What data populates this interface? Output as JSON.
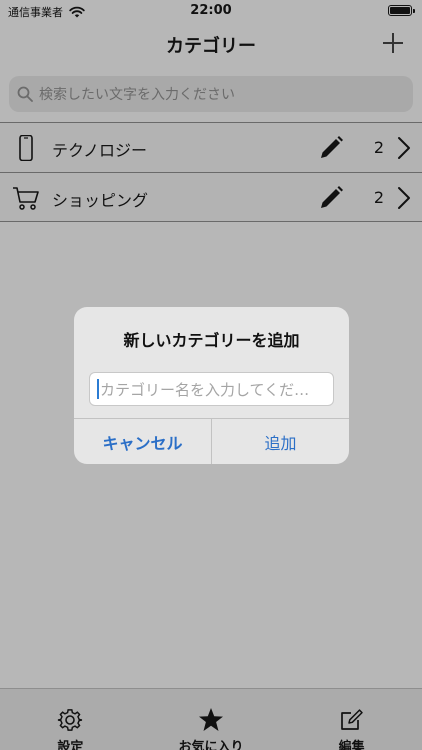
{
  "status_bar": {
    "carrier": "通信事業者",
    "time": "22:00"
  },
  "nav": {
    "title": "カテゴリー",
    "add_icon": "plus-icon"
  },
  "search": {
    "placeholder": "検索したい文字を入力ください",
    "icon": "search-icon"
  },
  "categories": [
    {
      "icon": "phone-icon",
      "label": "テクノロジー",
      "count": "2"
    },
    {
      "icon": "cart-icon",
      "label": "ショッピング",
      "count": "2"
    }
  ],
  "alert": {
    "title": "新しいカテゴリーを追加",
    "placeholder": "カテゴリー名を入力してくだ…",
    "cancel": "キャンセル",
    "add": "追加"
  },
  "tabs": [
    {
      "icon": "gear-icon",
      "label": "設定"
    },
    {
      "icon": "star-icon",
      "label": "お気に入り"
    },
    {
      "icon": "edit-icon",
      "label": "編集"
    }
  ],
  "colors": {
    "accent": "#2b6fc7",
    "background": "#b7b7b7"
  }
}
